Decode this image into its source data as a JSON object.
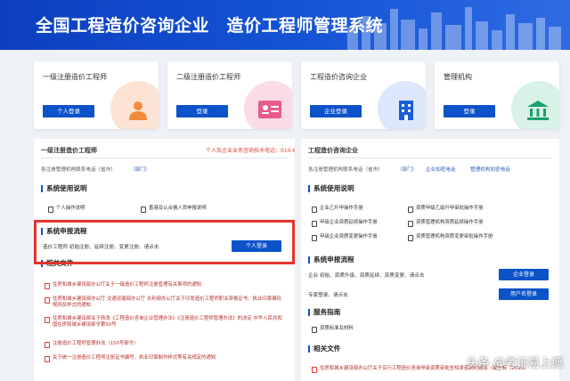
{
  "header": {
    "title": "全国工程造价咨询企业　造价工程师管理系统"
  },
  "cards": [
    {
      "title": "一级注册造价工程师",
      "button": "个人登录",
      "icon": "person-icon",
      "bg": "#fde3d3"
    },
    {
      "title": "二级注册造价工程师",
      "button": "登录",
      "icon": "id-card-icon",
      "bg": "#fbdbe4"
    },
    {
      "title": "工程造价咨询企业",
      "button": "企业登录",
      "icon": "building-icon",
      "bg": "#dce7fb"
    },
    {
      "title": "管理机构",
      "button": "登录",
      "icon": "institution-icon",
      "bg": "#d9f2e8"
    }
  ],
  "left": {
    "head": "一级注册造价工程师",
    "hotline": "个人及企业业务咨询技术电话：010-62041661",
    "dept_label": "各注册管理机构联系电话（省市）",
    "dept_link": "（部门）",
    "usage_title": "系统使用说明",
    "usage_docs": [
      "个人操作说明",
      "香港及认合格人员申报说明"
    ],
    "flow_title": "系统申报流程",
    "flow_text": "造价工程师 初始注册、延续注册、变更注册、请点击",
    "flow_button": "个人登录",
    "files_title": "相关文件",
    "files": [
      "住房和城乡建设部办公厅关于一级造价工程师注册管理有关事项的通知",
      "住房和城乡建设部办公厅 交通运输部办公厅 水利部办公厅关于印发造价工程师职业资格证书、执业印章编码规则及样式的通知",
      "住房和城乡建设部关于修改《工程造价咨询企业管理办法》《注册造价工程师管理办法》的决定 中华人民共和国住房和城乡建设部令第50号",
      "注册造价工程师管理办法（150号部令）",
      "关于统一注册造价工程师注册证书编号、执业印章制作样式等有关规定的通知"
    ]
  },
  "right": {
    "head": "工程造价咨询企业",
    "dept_label": "各注册管理机构联系电话（省市）",
    "dept_links": [
      "（部门）",
      "企业加密电话",
      "管理机构加密电话"
    ],
    "usage_title": "系统使用说明",
    "usage_docs": [
      "企业乙升甲操作手册",
      "资质甲级乙级升甲审批操作手册",
      "甲级企业资质延续操作手册",
      "资质管理机构资质延续操作手册",
      "甲级企业资质变更操作手册",
      "资质管理机构资质变更审批操作手册"
    ],
    "flow_title": "系统申报流程",
    "flow_text": "企业 初始、资质升级、资质延续、资质变更、请点击",
    "flow_button": "企业登录",
    "expert_text": "专家登录，请点击",
    "expert_button": "用户名登录",
    "service_title": "服务指南",
    "service_doc": "资质标准及材料",
    "files_title": "相关文件",
    "files": [
      "住房和城乡建设部办公厅关于实行工程造价咨询甲级资质审批告知承诺制的通知（建办标（2020）"
    ]
  },
  "watermark": "头条 @考证易上瘾"
}
